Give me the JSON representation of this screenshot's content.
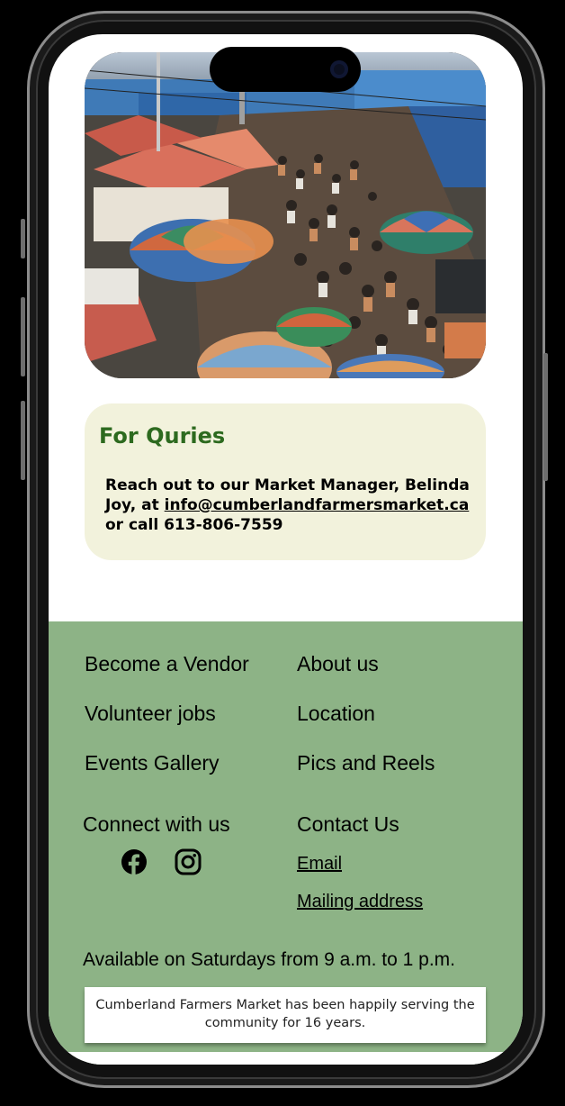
{
  "hero": {
    "image_alt": "Crowded outdoor market with colorful umbrellas and tents"
  },
  "queries": {
    "title": "For Quries",
    "text_before": "Reach out to our Market Manager, Belinda Joy, at ",
    "email": "info@cumberlandfarmersmarket.ca",
    "text_after": " or call 613-806-7559"
  },
  "footer": {
    "links_left": [
      "Become a Vendor",
      "Volunteer jobs",
      "Events Gallery"
    ],
    "links_right": [
      "About us",
      "Location",
      "Pics and Reels"
    ],
    "connect_heading": "Connect with us",
    "social_icons": [
      "facebook-icon",
      "instagram-icon"
    ],
    "contact_heading": "Contact Us",
    "contact_links": [
      "Email",
      "Mailing address"
    ],
    "hours": "Available on Saturdays from 9 a.m. to 1 p.m.",
    "about": "Cumberland Farmers Market has been happily serving the community for 16 years."
  },
  "colors": {
    "footer_bg": "#8db386",
    "card_bg": "#f2f2dc",
    "title_green": "#2d6a1f"
  }
}
